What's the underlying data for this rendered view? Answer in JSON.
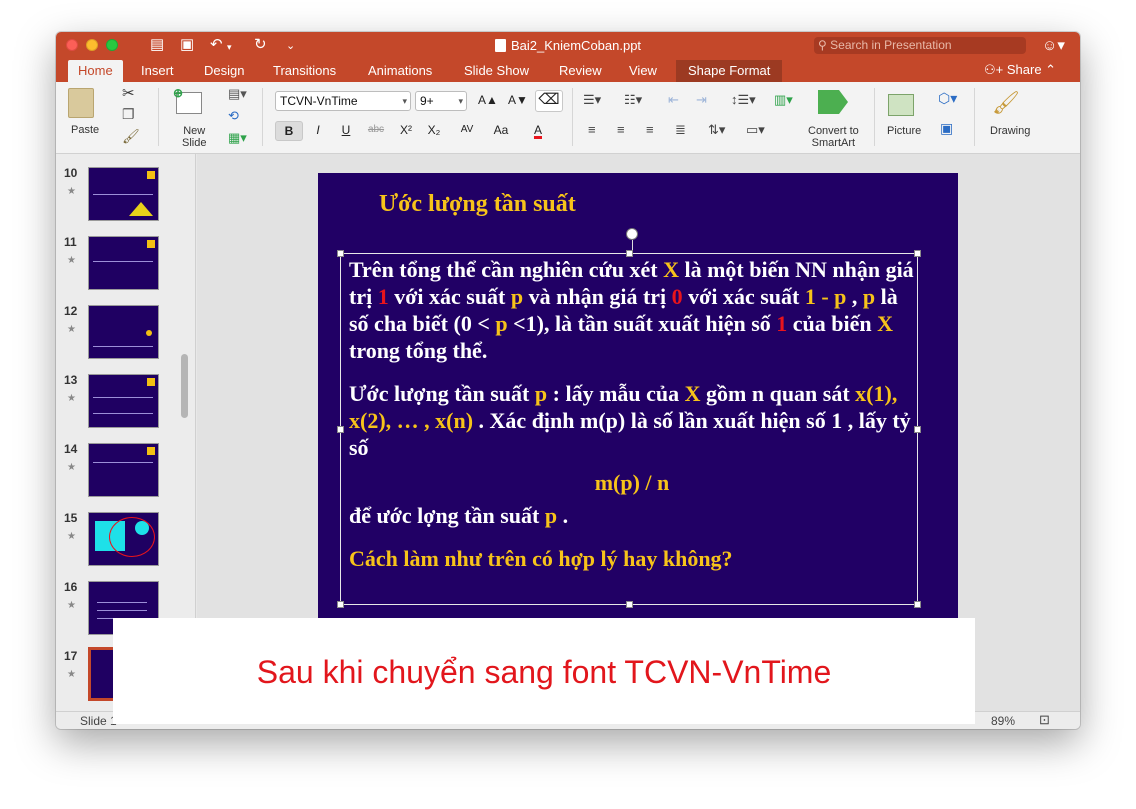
{
  "window": {
    "file_name": "Bai2_KniemCoban.ppt",
    "search_placeholder": "Search in Presentation",
    "share_label": "Share"
  },
  "tabs": [
    "Home",
    "Insert",
    "Design",
    "Transitions",
    "Animations",
    "Slide Show",
    "Review",
    "View",
    "Shape Format"
  ],
  "active_tab": "Home",
  "ribbon": {
    "paste_label": "Paste",
    "new_slide_label_1": "New",
    "new_slide_label_2": "Slide",
    "font_name": "TCVN-VnTime",
    "font_size": "9+",
    "convert_smartart_1": "Convert to",
    "convert_smartart_2": "SmartArt",
    "picture_label": "Picture",
    "drawing_label": "Drawing",
    "bold": "B",
    "italic": "I",
    "underline": "U",
    "strike": "abc",
    "superscript": "X²",
    "subscript": "X₂",
    "char_spacing": "AV",
    "change_case": "Aa",
    "font_color": "A",
    "grow_font": "A▲",
    "shrink_font": "A▼"
  },
  "thumbnails": [
    {
      "num": "10"
    },
    {
      "num": "11"
    },
    {
      "num": "12"
    },
    {
      "num": "13"
    },
    {
      "num": "14"
    },
    {
      "num": "15"
    },
    {
      "num": "16"
    },
    {
      "num": "17"
    }
  ],
  "slide": {
    "title": "Ước lượng tần suất",
    "p1": {
      "a": "Trên tổng thể cần nghiên cứu xét ",
      "x": "X",
      "b": "  là một biến NN nhận giá trị  ",
      "one": "1",
      "c": "  với xác suất ",
      "p1": "p",
      "d": "  và nhận giá trị  ",
      "zero": "0",
      "e": "  với xác suất  ",
      "onep": "1 - p",
      "f": " ,  ",
      "p2": "p",
      "g": "  là số cha biết (0 < ",
      "p3": "p",
      "h": " <1), là tần suất xuất hiện số ",
      "one2": "1",
      "i": " của biến  ",
      "x2": "X",
      "j": " trong tổng thể."
    },
    "p2": {
      "a": "Ước lượng tần suất  ",
      "p": "p",
      "b": " : lấy mẫu của  ",
      "x": "X",
      "c": "  gồm  n  quan sát  ",
      "xs": "x(1), x(2), … , x(n)",
      "d": " . Xác định   m(p)  là số lần xuất hiện số  1 , lấy tỷ số"
    },
    "formula": "m(p) / n",
    "p3": {
      "a": "để ước lợng tần suất  ",
      "p": "p",
      "b": " ."
    },
    "question": "Cách làm như trên có hợp lý hay không?"
  },
  "status": {
    "slide_label": "Slide 1",
    "zoom": "89%"
  },
  "caption": "Sau khi chuyển sang font TCVN-VnTime"
}
